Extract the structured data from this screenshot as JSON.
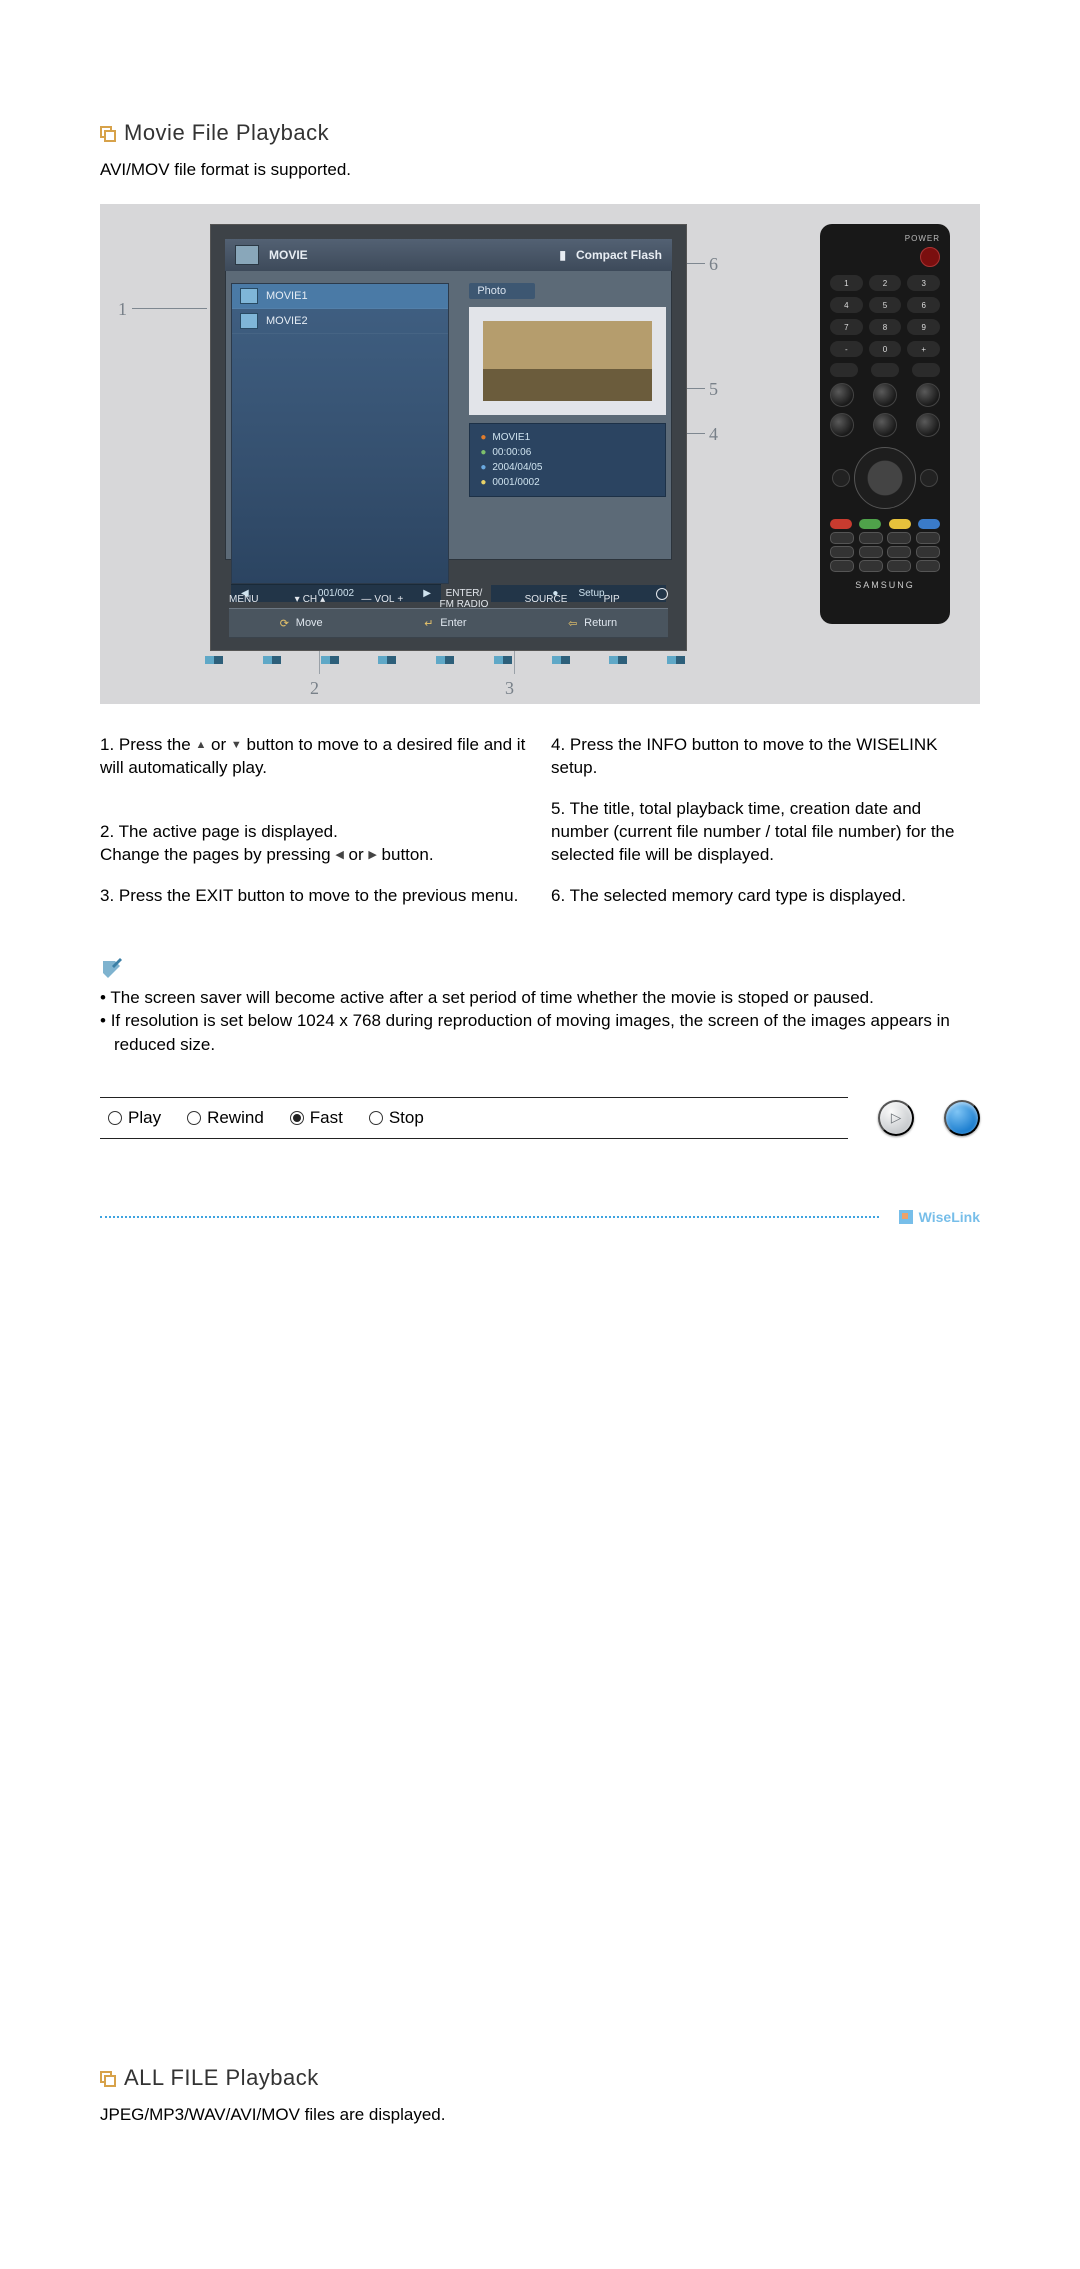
{
  "section1": {
    "title": "Movie File Playback",
    "subtitle": "AVI/MOV file format is supported."
  },
  "diagram": {
    "callouts": {
      "n1": "1",
      "n2": "2",
      "n3": "3",
      "n4": "4",
      "n5": "5",
      "n6": "6"
    },
    "topbar": {
      "mode": "MOVIE",
      "card_icon": "card-icon",
      "card_label": "Compact Flash"
    },
    "files": [
      {
        "name": "MOVIE1",
        "selected": true
      },
      {
        "name": "MOVIE2",
        "selected": false
      }
    ],
    "pager": {
      "left_arrow": "◀",
      "text": "001/002",
      "right_arrow": "▶"
    },
    "preview_label": "Photo",
    "meta": {
      "title": "MOVIE1",
      "duration": "00:00:06",
      "date": "2004/04/05",
      "index": "0001/0002"
    },
    "setup": {
      "icon": "●",
      "label": "Setup"
    },
    "helpbar": {
      "move": "Move",
      "enter": "Enter",
      "return": "Return"
    },
    "tv_buttons": {
      "menu": "MENU",
      "ch": "CH",
      "vol": "VOL",
      "enter_fm": "ENTER/\nFM RADIO",
      "source": "SOURCE",
      "pip": "PIP",
      "power": "⏻"
    },
    "remote": {
      "power_label": "POWER",
      "numbers": [
        "1",
        "2",
        "3",
        "4",
        "5",
        "6",
        "7",
        "8",
        "9",
        "-",
        "0",
        "+"
      ],
      "brand": "SAMSUNG"
    }
  },
  "steps": {
    "s1_a": "1. Press the ",
    "s1_mid": " or ",
    "s1_b": " button to move to a desired file and it will automatically play.",
    "s2_a": "2. The active page is displayed.\nChange the pages by pressing ",
    "s2_mid": " or ",
    "s2_b": " button.",
    "s3": "3. Press the EXIT button to move to the previous menu.",
    "s4": "4. Press the INFO button to move to the WISELINK setup.",
    "s5": "5. The title, total playback time, creation date and number (current file number / total file number) for the selected file will be displayed.",
    "s6": "6. The selected memory card type is displayed."
  },
  "notes": [
    "The screen saver will become active after a set period of time whether the movie is stoped or paused.",
    "If resolution is set below 1024 x 768 during reproduction of moving images, the screen of the images appears in reduced size."
  ],
  "controls": {
    "options": [
      "Play",
      "Rewind",
      "Fast",
      "Stop"
    ],
    "selected": "Fast"
  },
  "footer": {
    "logo_text": "WiseLink"
  },
  "section2": {
    "title": "ALL FILE Playback",
    "subtitle": "JPEG/MP3/WAV/AVI/MOV files are displayed."
  }
}
